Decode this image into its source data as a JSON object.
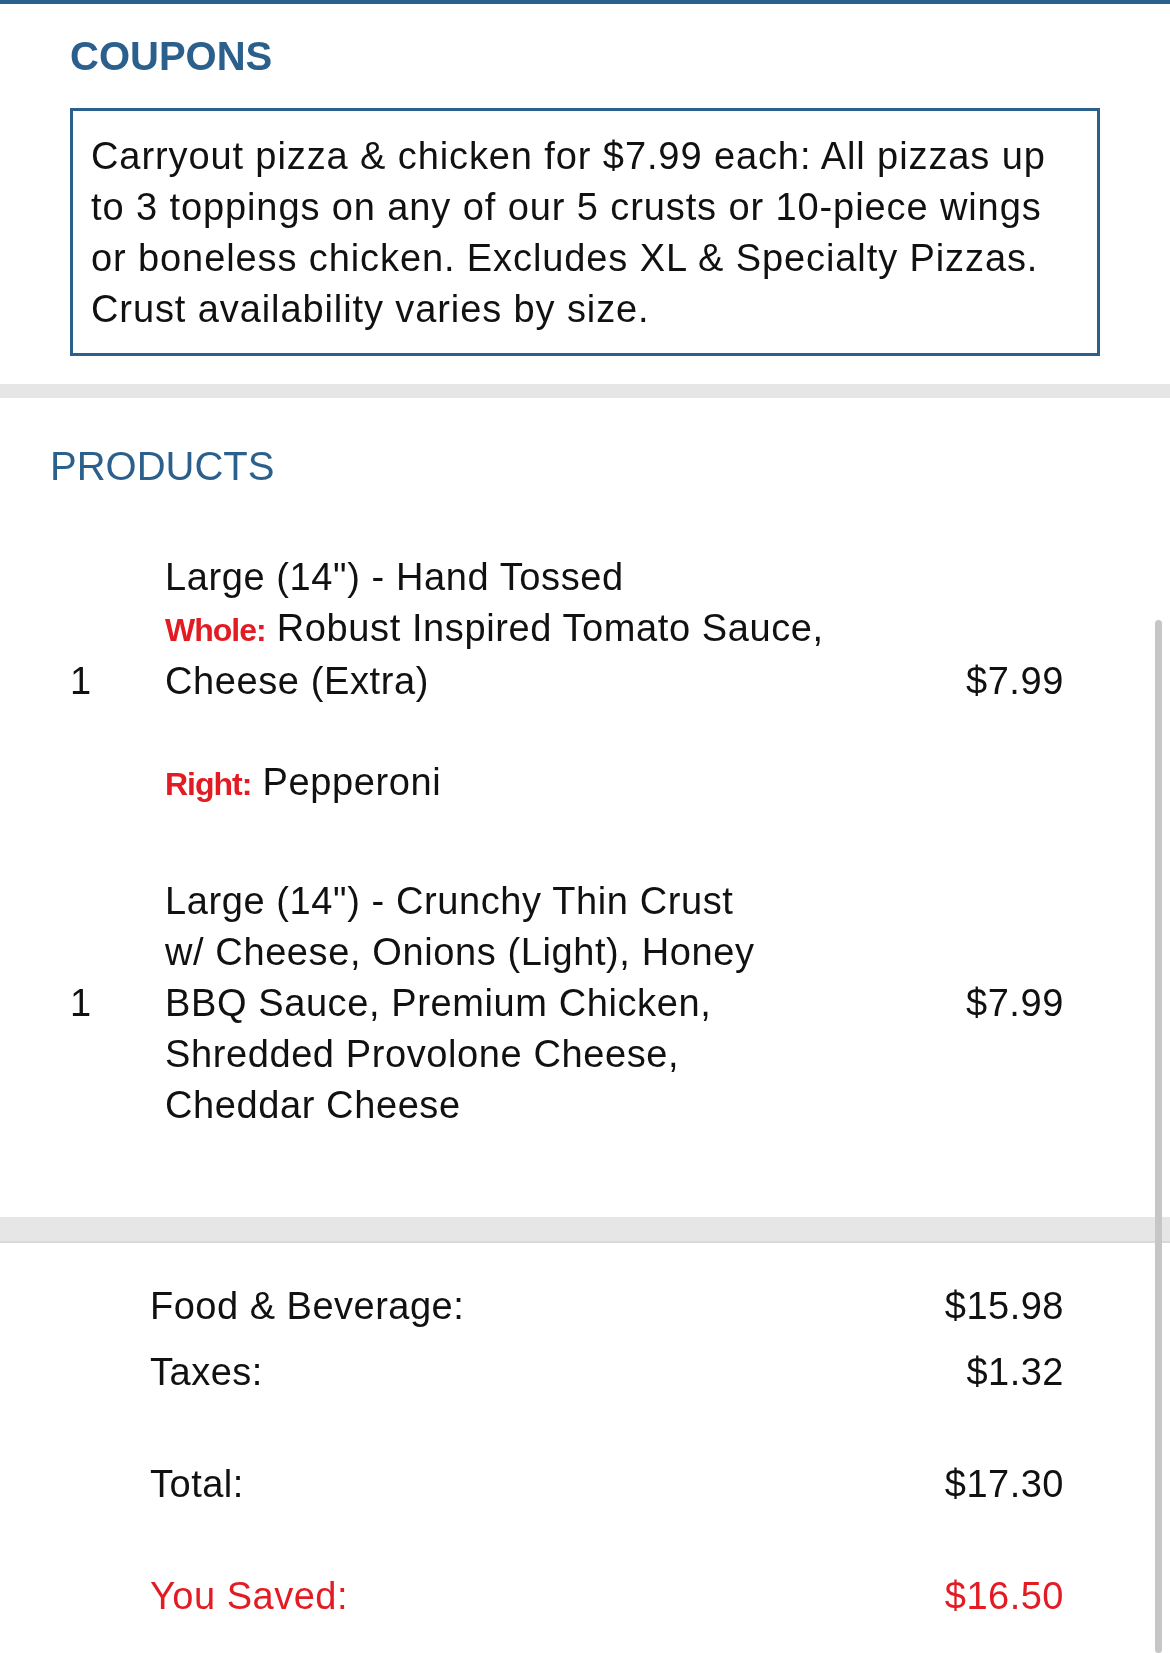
{
  "coupons": {
    "title": "COUPONS",
    "description": "Carryout pizza & chicken for $7.99 each: All pizzas up to 3 toppings on any of our 5 crusts or 10-piece wings or boneless chicken. Excludes XL & Specialty Pizzas. Crust availability varies by size."
  },
  "products": {
    "title": "PRODUCTS",
    "items": [
      {
        "quantity": "1",
        "name": "Large (14\") - Hand Tossed",
        "price": "$7.99",
        "toppings": [
          {
            "placement": "Whole:",
            "text": "Robust Inspired Tomato Sauce, Cheese (Extra)"
          },
          {
            "placement": "Right:",
            "text": "Pepperoni"
          }
        ]
      },
      {
        "quantity": "1",
        "name": "Large (14\") - Crunchy Thin Crust",
        "price": "$7.99",
        "toppings": [
          {
            "text": "w/ Cheese, Onions (Light), Honey BBQ Sauce, Premium Chicken, Shredded Provolone Cheese, Cheddar Cheese"
          }
        ]
      }
    ]
  },
  "summary": [
    {
      "kind": "line",
      "label": "Food & Beverage:",
      "value": "$15.98"
    },
    {
      "kind": "line",
      "label": "Taxes:",
      "value": "$1.32"
    },
    {
      "kind": "total",
      "label": "Total:",
      "value": "$17.30"
    },
    {
      "kind": "savings",
      "label": "You Saved:",
      "value": "$16.50"
    }
  ]
}
